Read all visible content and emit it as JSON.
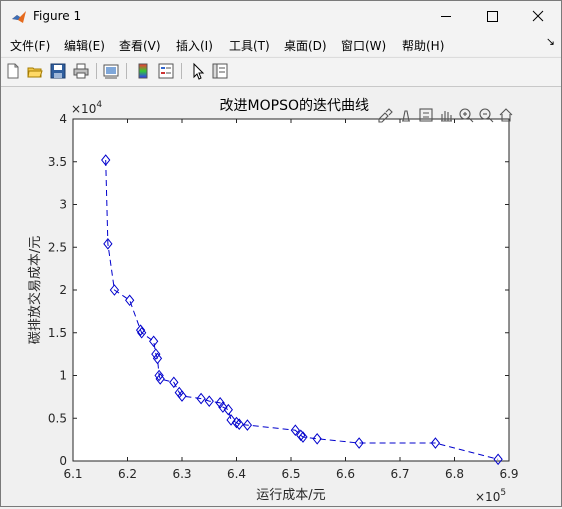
{
  "window": {
    "title": "Figure 1"
  },
  "menu": {
    "items": [
      "文件(F)",
      "编辑(E)",
      "查看(V)",
      "插入(I)",
      "工具(T)",
      "桌面(D)",
      "窗口(W)",
      "帮助(H)"
    ]
  },
  "axes_toolbar": {
    "icons": [
      "brush-icon",
      "data-tip-icon",
      "legend-toggle-icon",
      "pan-icon",
      "zoom-in-icon",
      "zoom-out-icon",
      "home-icon"
    ]
  },
  "chart_data": {
    "type": "line",
    "title": "改进MOPSO的迭代曲线",
    "xlabel": "运行成本/元",
    "ylabel": "碳排放交易成本/元",
    "x_multiplier": "×10^5",
    "y_multiplier": "×10^4",
    "xlim": [
      610000,
      690000
    ],
    "ylim": [
      0,
      40000
    ],
    "xtick_labels": [
      "6.1",
      "6.2",
      "6.3",
      "6.4",
      "6.5",
      "6.6",
      "6.7",
      "6.8",
      "6.9"
    ],
    "ytick_labels": [
      "0",
      "0.5",
      "1",
      "1.5",
      "2",
      "2.5",
      "3",
      "3.5",
      "4"
    ],
    "marker": "diamond",
    "line_style": "dashed",
    "color": "#0000cc",
    "series": [
      {
        "x": [
          616000,
          616400,
          617600,
          620400,
          622400,
          622600,
          624800,
          625200,
          625500,
          625800,
          626000,
          628500,
          629500,
          630000,
          633500,
          635000,
          637000,
          637500,
          638500,
          639000,
          640000,
          640500,
          642000,
          650800,
          651800,
          652200,
          654800,
          662500,
          676500,
          688000
        ],
        "y": [
          35200,
          25400,
          20000,
          18800,
          15300,
          15000,
          14000,
          12500,
          12000,
          10000,
          9600,
          9200,
          8000,
          7600,
          7300,
          7000,
          6800,
          6300,
          6000,
          4800,
          4500,
          4300,
          4200,
          3600,
          3000,
          2800,
          2600,
          2100,
          2100,
          200
        ]
      }
    ]
  }
}
